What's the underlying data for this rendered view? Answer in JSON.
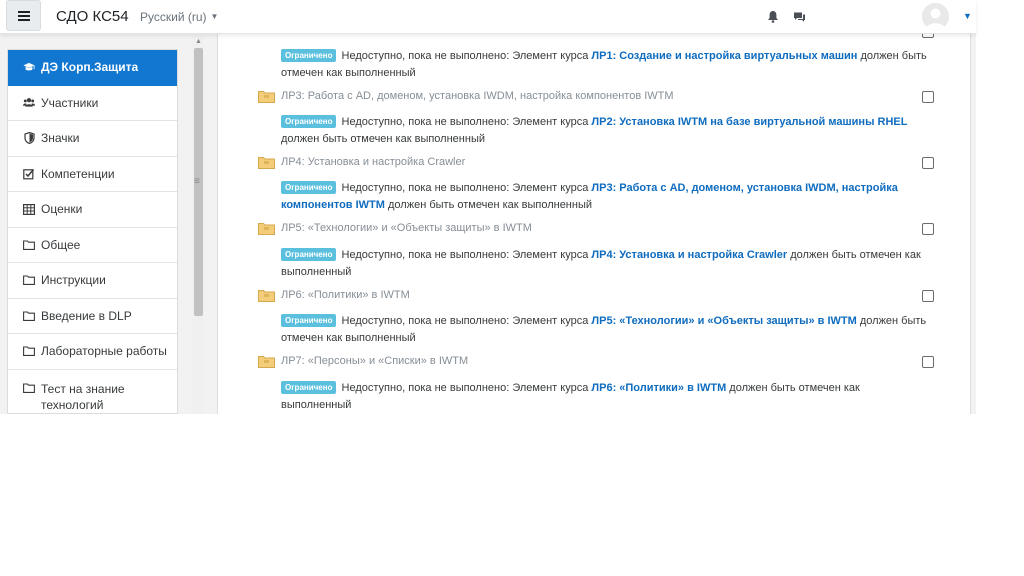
{
  "header": {
    "site_name": "СДО КС54",
    "language": "Русский (ru)"
  },
  "drawer": {
    "items": [
      {
        "label": "ДЭ Корп.Защита",
        "icon": "graduation-cap-icon",
        "active": true
      },
      {
        "label": "Участники",
        "icon": "users-icon"
      },
      {
        "label": "Значки",
        "icon": "shield-icon"
      },
      {
        "label": "Компетенции",
        "icon": "checkbox-icon"
      },
      {
        "label": "Оценки",
        "icon": "table-icon"
      },
      {
        "label": "Общее",
        "icon": "folder-icon"
      },
      {
        "label": "Инструкции",
        "icon": "folder-icon"
      },
      {
        "label": "Введение в DLP",
        "icon": "folder-icon"
      },
      {
        "label": "Лабораторные работы",
        "icon": "folder-icon"
      },
      {
        "label": "Тест на знание технологий",
        "icon": "folder-icon"
      }
    ]
  },
  "restriction": {
    "badge": "Ограничено",
    "prefix": "Недоступно, пока не выполнено: Элемент курса",
    "suffix": "должен быть отмечен как выполненный"
  },
  "activities": [
    {
      "title": "ЛР3: Работа с AD, доменом, установка IWDM, настройка компонентов IWTM"
    },
    {
      "title": "ЛР4: Установка и настройка Crawler"
    },
    {
      "title": "ЛР5: «Технологии» и «Объекты защиты» в IWTM"
    },
    {
      "title": "ЛР6: «Политики» в IWTM"
    },
    {
      "title": "ЛР7: «Персоны» и «Списки» в IWTM"
    }
  ],
  "restrictions": [
    {
      "link": "ЛР1: Создание и настройка виртуальных машин"
    },
    {
      "link": "ЛР2: Установка IWTM на базе виртуальной машины RHEL"
    },
    {
      "link": "ЛР3: Работа с AD, доменом, установка IWDM, настройка компонентов IWTM"
    },
    {
      "link": "ЛР4: Установка и настройка Crawler"
    },
    {
      "link": "ЛР5: «Технологии» и «Объекты защиты» в IWTM"
    },
    {
      "link": "ЛР6: «Политики» в IWTM"
    }
  ],
  "colors": {
    "accent": "#1177d1",
    "link": "#0f6cbf",
    "badge": "#5bc0de"
  }
}
